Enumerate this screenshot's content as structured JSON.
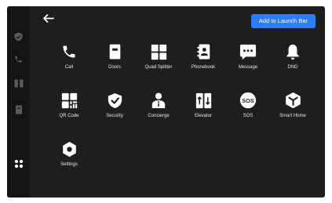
{
  "header": {
    "back_icon": "arrow-left-icon",
    "launch_bar_button": "Add to Launch Bar"
  },
  "sidebar": {
    "items": [
      {
        "icon": "shield-check-icon"
      },
      {
        "icon": "phone-icon"
      },
      {
        "icon": "split-panel-icon"
      },
      {
        "icon": "door-icon"
      },
      {
        "icon": "grid-apps-icon",
        "active": true
      }
    ]
  },
  "apps": [
    {
      "label": "Call",
      "icon": "phone-icon"
    },
    {
      "label": "Doors",
      "icon": "door-icon"
    },
    {
      "label": "Quad Splitter",
      "icon": "quad-splitter-icon"
    },
    {
      "label": "Phonebook",
      "icon": "phonebook-icon"
    },
    {
      "label": "Message",
      "icon": "message-icon"
    },
    {
      "label": "DND",
      "icon": "bell-icon"
    },
    {
      "label": "QR Code",
      "icon": "qr-code-icon"
    },
    {
      "label": "Security",
      "icon": "shield-check-icon"
    },
    {
      "label": "Concierge",
      "icon": "concierge-icon"
    },
    {
      "label": "Elevator",
      "icon": "elevator-icon"
    },
    {
      "label": "SOS",
      "icon": "sos-icon",
      "icon_text": "SOS"
    },
    {
      "label": "Smart Home",
      "icon": "smart-home-icon"
    },
    {
      "label": "Settings",
      "icon": "gear-icon"
    }
  ],
  "colors": {
    "background": "#1e1e1e",
    "sidebar": "#141414",
    "accent": "#2f7df6",
    "icon": "#ffffff",
    "sidebar_icon": "#5a5a5a"
  }
}
